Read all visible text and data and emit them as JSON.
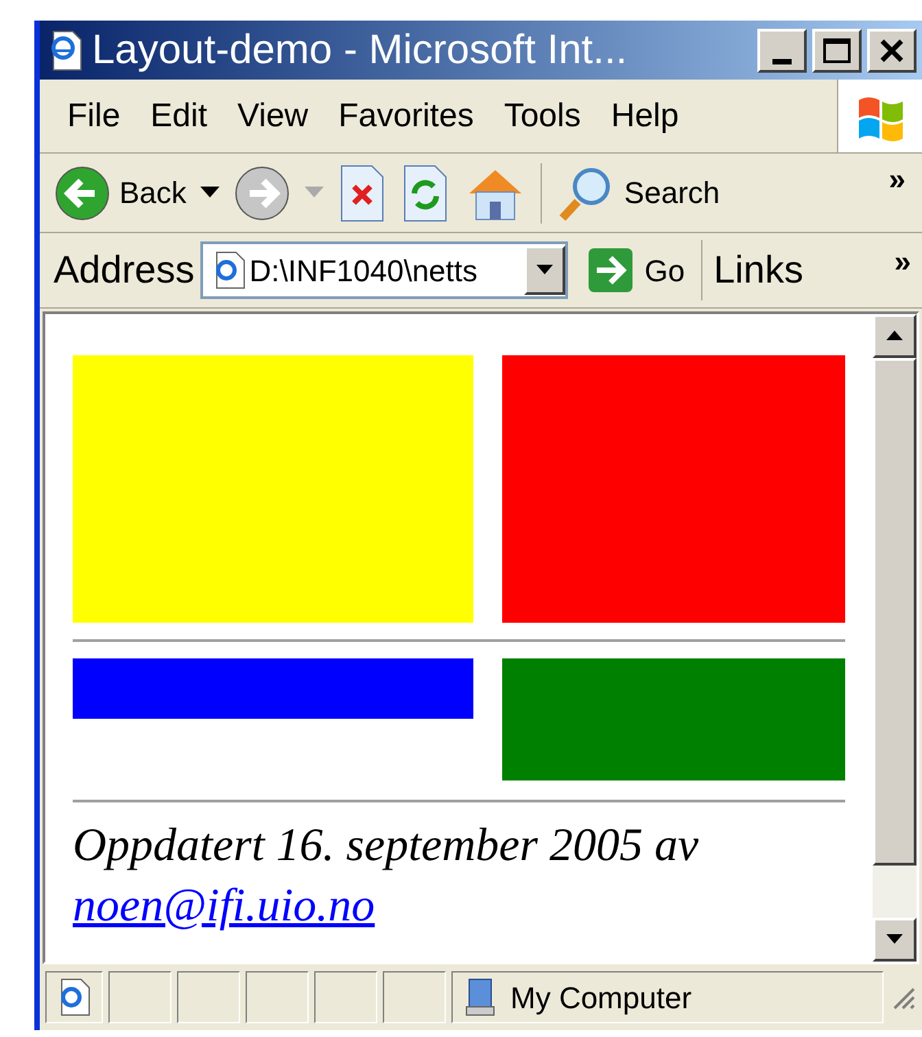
{
  "window": {
    "title": "Layout-demo - Microsoft Int..."
  },
  "menu": [
    "File",
    "Edit",
    "View",
    "Favorites",
    "Tools",
    "Help"
  ],
  "toolbar": [
    {
      "kind": "back",
      "label": "Back",
      "disabled": false
    },
    {
      "kind": "forward",
      "disabled": true
    },
    {
      "kind": "stop"
    },
    {
      "kind": "refresh"
    },
    {
      "kind": "home"
    },
    {
      "kind": "search",
      "label": "Search"
    }
  ],
  "toolbar_more": "»",
  "address_bar": {
    "label": "Address",
    "value": "D:\\INF1040\\netts",
    "go": "Go",
    "links": "Links",
    "more": "»"
  },
  "page": {
    "rows": [
      [
        {
          "color": "#ffff00",
          "kind": "tall"
        },
        {
          "color": "#ff0000",
          "kind": "tall"
        }
      ],
      [
        {
          "color": "#0000ff",
          "kind": "short"
        },
        {
          "color": "#008000",
          "kind": "medium"
        }
      ]
    ],
    "footer": "Oppdatert 16. september 2005 av",
    "email": "noen@ifi.uio.no"
  },
  "status_bar": {
    "zone": "My Computer"
  }
}
